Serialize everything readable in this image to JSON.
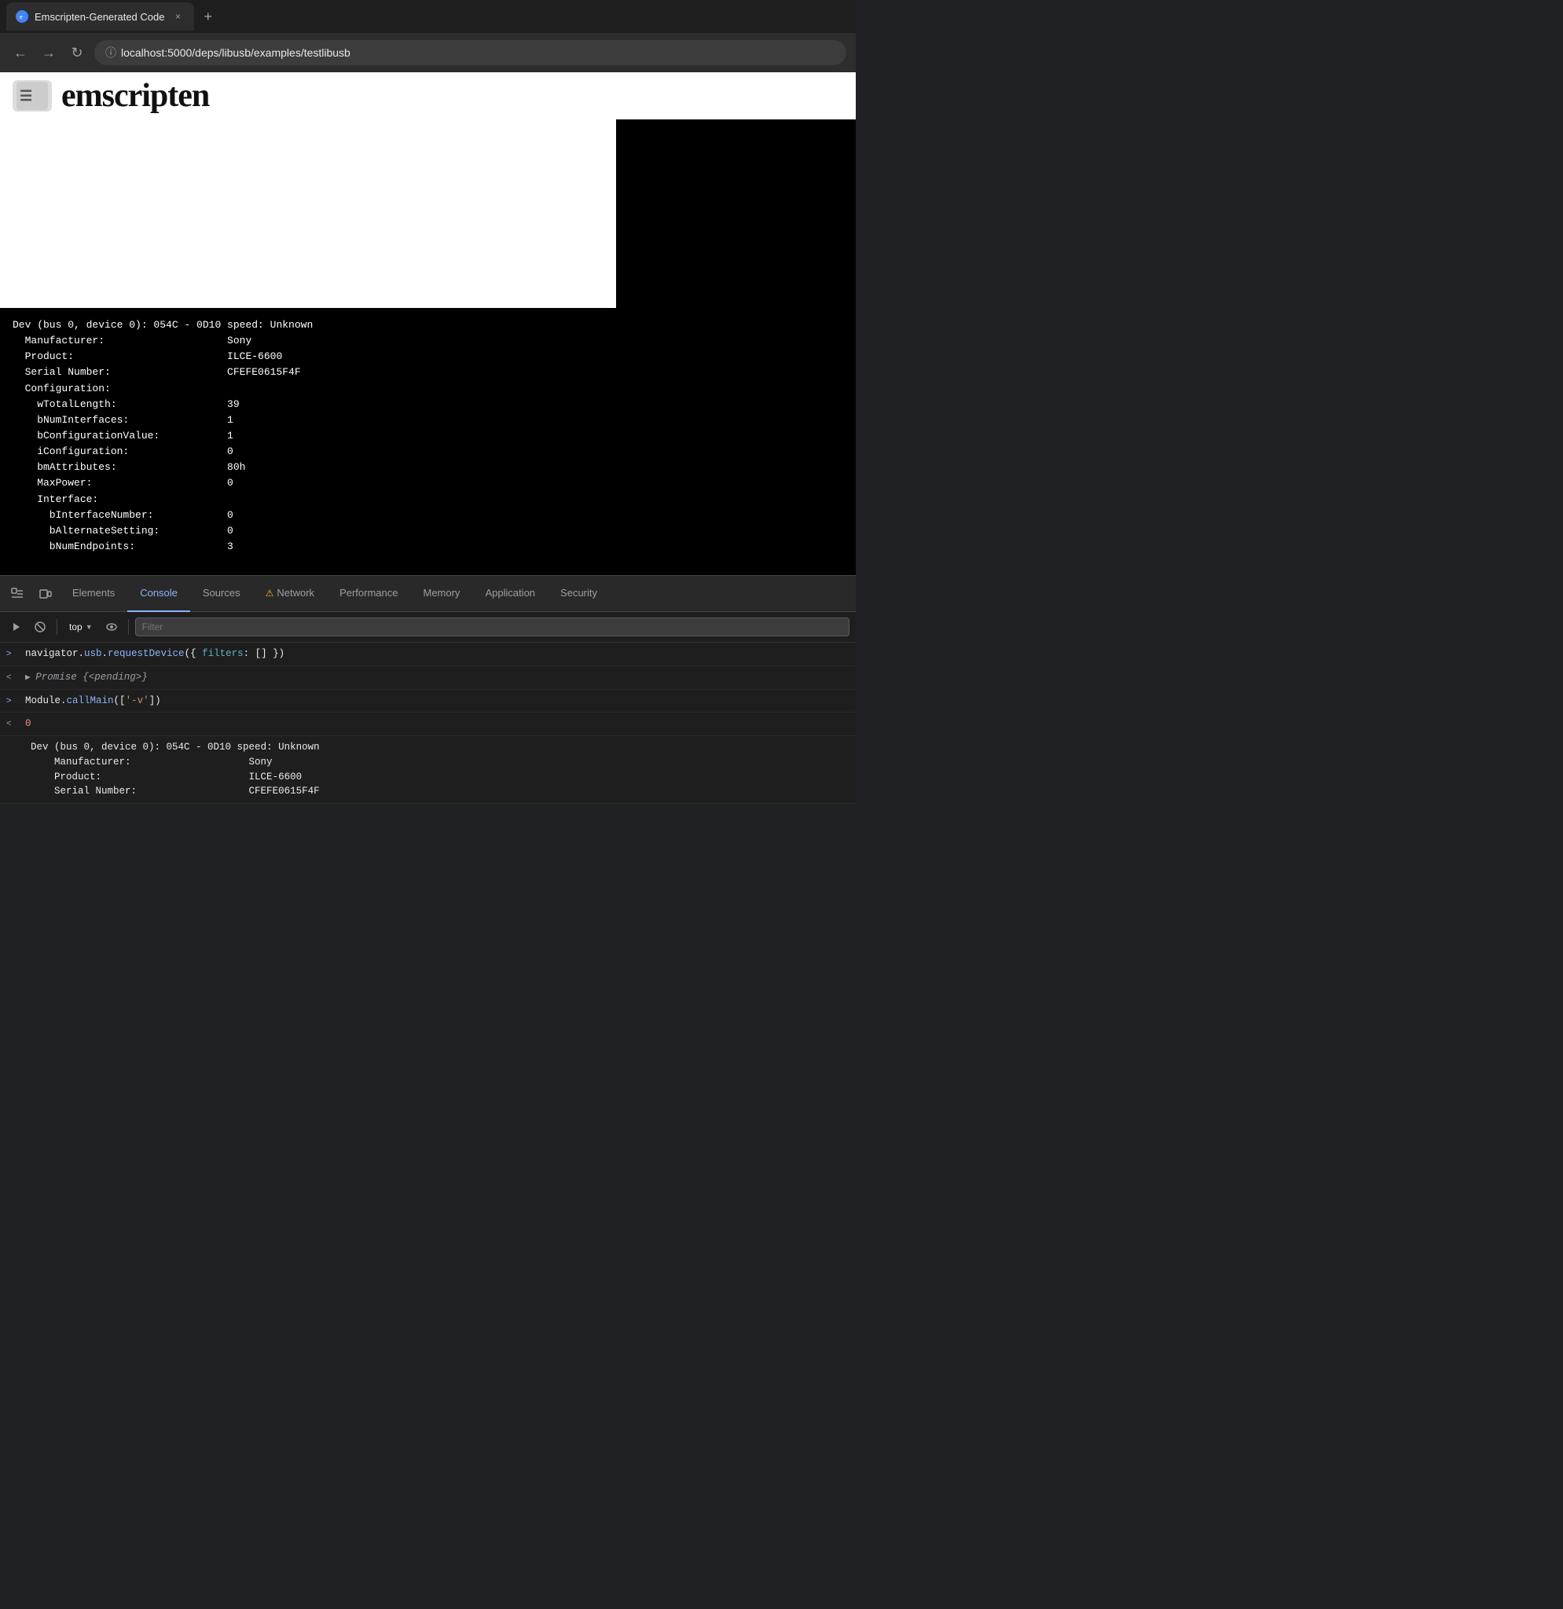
{
  "browser": {
    "tab_title": "Emscripten-Generated Code",
    "tab_close": "×",
    "new_tab": "+",
    "url": "localhost:5000/deps/libusb/examples/testlibusb",
    "nav": {
      "back": "←",
      "forward": "→",
      "reload": "↻",
      "info_icon": "ⓘ"
    }
  },
  "page": {
    "logo_text": "☰",
    "title": "emscripten"
  },
  "terminal": {
    "lines": [
      "Dev (bus 0, device 0): 054C - 0D10 speed: Unknown",
      "  Manufacturer:                    Sony",
      "  Product:                         ILCE-6600",
      "  Serial Number:                   CFEFE0615F4F",
      "  Configuration:",
      "    wTotalLength:                  39",
      "    bNumInterfaces:                1",
      "    bConfigurationValue:           1",
      "    iConfiguration:                0",
      "    bmAttributes:                  80h",
      "    MaxPower:                      0",
      "    Interface:",
      "      bInterfaceNumber:            0",
      "      bAlternateSetting:           0",
      "      bNumEndpoints:               3"
    ]
  },
  "devtools": {
    "icon_btn1": "⬚",
    "icon_btn2": "⬜",
    "tabs": [
      {
        "id": "elements",
        "label": "Elements",
        "active": false,
        "warning": false
      },
      {
        "id": "console",
        "label": "Console",
        "active": true,
        "warning": false
      },
      {
        "id": "sources",
        "label": "Sources",
        "active": false,
        "warning": false
      },
      {
        "id": "network",
        "label": "Network",
        "active": false,
        "warning": true
      },
      {
        "id": "performance",
        "label": "Performance",
        "active": false,
        "warning": false
      },
      {
        "id": "memory",
        "label": "Memory",
        "active": false,
        "warning": false
      },
      {
        "id": "application",
        "label": "Application",
        "active": false,
        "warning": false
      },
      {
        "id": "security",
        "label": "Security",
        "active": false,
        "warning": false
      }
    ]
  },
  "console_toolbar": {
    "run_btn": "▶",
    "stop_btn": "⊘",
    "top_label": "top",
    "dropdown_arrow": "▼",
    "eye_icon": "👁",
    "filter_placeholder": "Filter"
  },
  "console_lines": [
    {
      "type": "input",
      "arrow": ">",
      "parts": [
        {
          "text": "navigator.",
          "class": "code-white"
        },
        {
          "text": "usb",
          "class": "code-blue"
        },
        {
          "text": ".requestDevice({ filters: [] })",
          "class": "code-white"
        }
      ]
    },
    {
      "type": "output",
      "arrow": "<",
      "parts": [
        {
          "text": "▶ ",
          "class": "code-gray"
        },
        {
          "text": "Promise {<pending>}",
          "class": "code-italic"
        }
      ]
    },
    {
      "type": "input",
      "arrow": ">",
      "parts": [
        {
          "text": "Module",
          "class": "code-white"
        },
        {
          "text": ".callMain(['-v'])",
          "class": "code-white"
        }
      ]
    },
    {
      "type": "output",
      "arrow": "<",
      "parts": [
        {
          "text": "0",
          "class": "code-number"
        }
      ]
    }
  ],
  "console_device": {
    "line1": "Dev (bus 0, device 0): 054C - 0D10 speed: Unknown",
    "line2": "  Manufacturer:                    Sony",
    "line3": "  Product:                         ILCE-6600",
    "line4": "  Serial Number:                   CFEFE0615F4F"
  }
}
